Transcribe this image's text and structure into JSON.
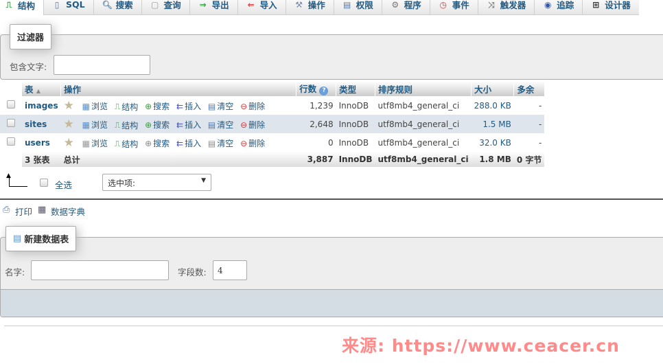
{
  "tabs": [
    {
      "label": "结构",
      "icon": "structure-icon",
      "active": true
    },
    {
      "label": "SQL",
      "icon": "sql-icon"
    },
    {
      "label": "搜索",
      "icon": "search-icon"
    },
    {
      "label": "查询",
      "icon": "query-icon"
    },
    {
      "label": "导出",
      "icon": "export-icon"
    },
    {
      "label": "导入",
      "icon": "import-icon"
    },
    {
      "label": "操作",
      "icon": "wrench-icon"
    },
    {
      "label": "权限",
      "icon": "privileges-icon"
    },
    {
      "label": "程序",
      "icon": "routines-icon"
    },
    {
      "label": "事件",
      "icon": "clock-icon"
    },
    {
      "label": "触发器",
      "icon": "trigger-icon"
    },
    {
      "label": "追踪",
      "icon": "eye-icon"
    },
    {
      "label": "设计器",
      "icon": "designer-icon"
    }
  ],
  "filter": {
    "legend": "过滤器",
    "label": "包含文字:",
    "value": ""
  },
  "table": {
    "headers": {
      "table": "表",
      "actions": "操作",
      "rows": "行数",
      "type": "类型",
      "collation": "排序规则",
      "size": "大小",
      "overhead": "多余"
    },
    "action_labels": {
      "browse": "浏览",
      "structure": "结构",
      "search": "搜索",
      "insert": "插入",
      "empty": "清空",
      "drop": "删除"
    },
    "rows": [
      {
        "name": "images",
        "rows": "1,239",
        "type": "InnoDB",
        "collation": "utf8mb4_general_ci",
        "size": "288.0 KB",
        "overhead": "-"
      },
      {
        "name": "sites",
        "rows": "2,648",
        "type": "InnoDB",
        "collation": "utf8mb4_general_ci",
        "size": "1.5 MB",
        "overhead": "-"
      },
      {
        "name": "users",
        "rows": "0",
        "type": "InnoDB",
        "collation": "utf8mb4_general_ci",
        "size": "32.0 KB",
        "overhead": "-"
      }
    ],
    "total": {
      "count": "3 张表",
      "label": "总计",
      "rows": "3,887",
      "type": "InnoDB",
      "collation": "utf8mb4_general_ci",
      "size": "1.8 MB",
      "overhead": "0 字节"
    }
  },
  "bulk": {
    "check_all": "全选",
    "select_value": "选中项:"
  },
  "links": {
    "print": "打印",
    "dictionary": "数据字典"
  },
  "create": {
    "legend": "新建数据表",
    "name_label": "名字:",
    "name_value": "",
    "columns_label": "字段数:",
    "columns_value": "4"
  },
  "watermark": "来源: https://www.ceacer.cn"
}
